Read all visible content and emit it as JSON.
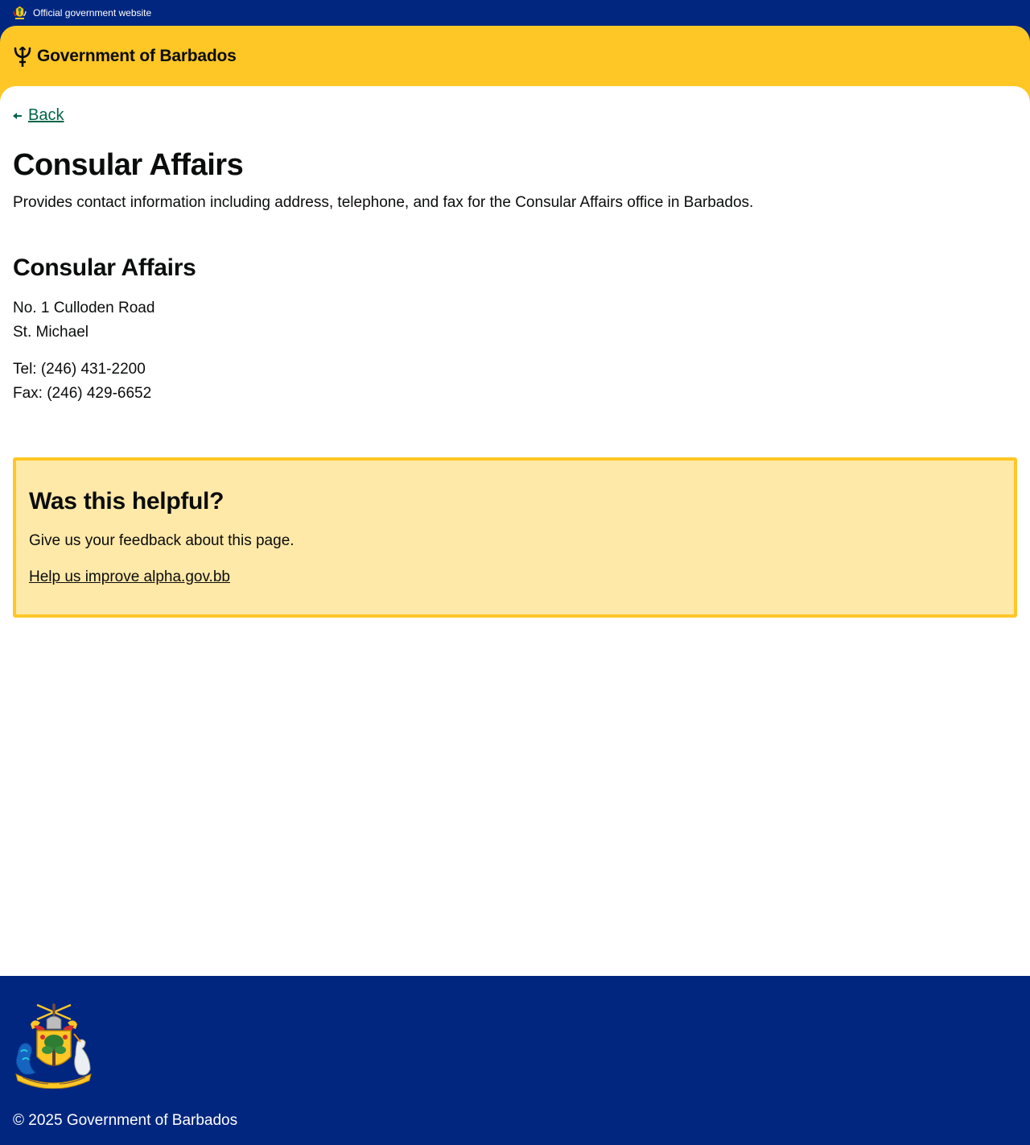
{
  "topbar": {
    "official_text": "Official government website",
    "crest_icon": "barbados-crest-icon"
  },
  "header": {
    "logo_icon": "trident-icon",
    "site_name": "Government of Barbados"
  },
  "nav": {
    "back_label": "Back",
    "back_icon": "arrow-left-icon"
  },
  "page": {
    "title": "Consular Affairs",
    "summary": "Provides contact information including address, telephone, and fax for the Consular Affairs office in Barbados."
  },
  "office": {
    "heading": "Consular Affairs",
    "address_line1": "No. 1 Culloden Road",
    "address_line2": "St. Michael",
    "tel": "Tel: (246) 431-2200",
    "fax": "Fax: (246) 429-6652"
  },
  "feedback": {
    "heading": "Was this helpful?",
    "text": "Give us your feedback about this page.",
    "link_label": "Help us improve alpha.gov.bb"
  },
  "footer": {
    "coat_of_arms_icon": "barbados-coat-of-arms-icon",
    "copyright": "© 2025 Government of Barbados"
  },
  "colors": {
    "navy": "#00267f",
    "gold": "#ffc726",
    "feedback_bg": "#ffe9a8",
    "link_green": "#00654a",
    "text": "#0b0c0c"
  }
}
